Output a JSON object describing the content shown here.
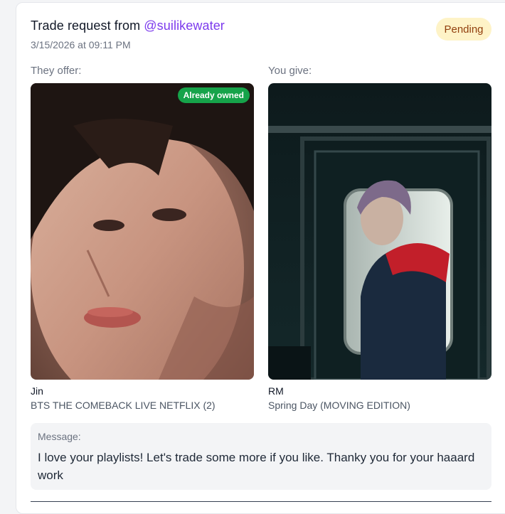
{
  "trade": {
    "title_prefix": "Trade request from ",
    "username": "@suilikewater",
    "timestamp": "3/15/2026 at 09:11 PM",
    "status": "Pending"
  },
  "offer": {
    "label": "They offer:",
    "badge": "Already owned",
    "name": "Jin",
    "set": "BTS THE COMEBACK LIVE NETFLIX (2)"
  },
  "give": {
    "label": "You give:",
    "name": "RM",
    "set": "Spring Day (MOVING EDITION)"
  },
  "message": {
    "label": "Message:",
    "text": "I love your playlists! Let's trade some more if you like. Thanky you for your haaard work"
  },
  "colors": {
    "accent": "#7c3aed",
    "pending_bg": "#fef3c7",
    "owned_badge": "#16a34a"
  }
}
